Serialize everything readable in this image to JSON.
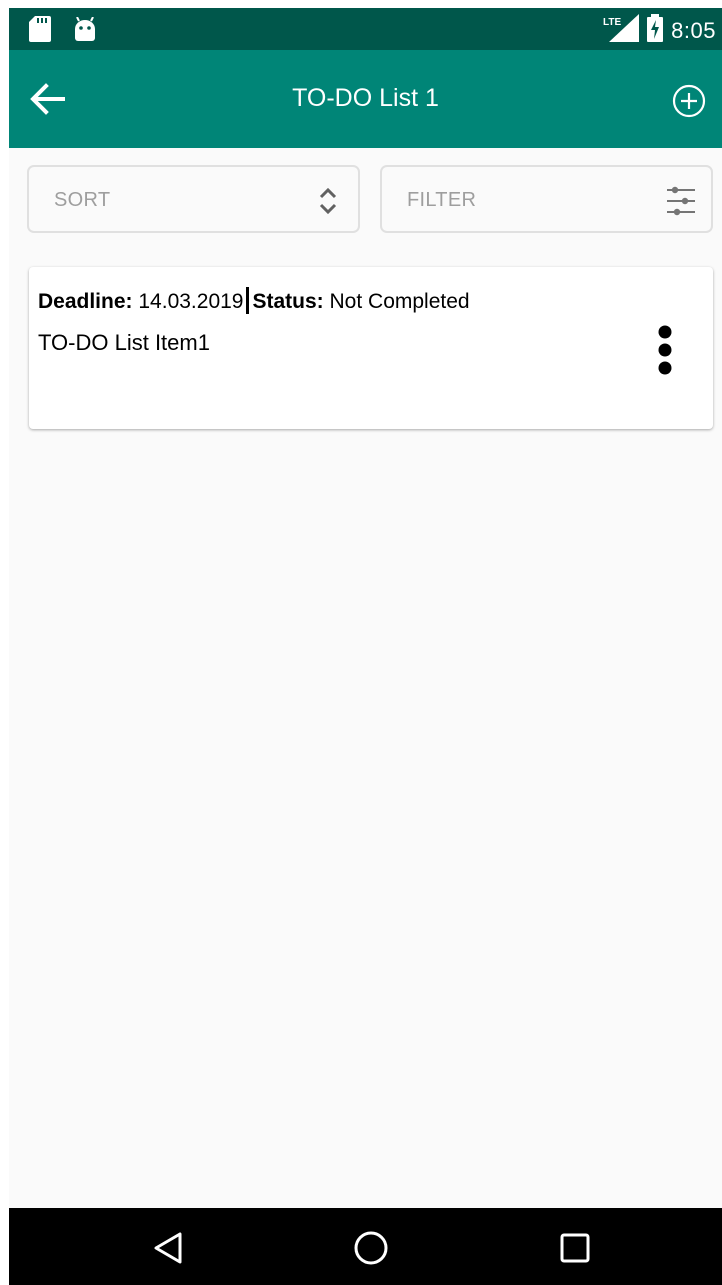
{
  "status_bar": {
    "time": "8:05",
    "network": "LTE",
    "icons": [
      "sd-card-icon",
      "android-icon",
      "lte-signal-icon",
      "battery-charging-icon"
    ]
  },
  "app_bar": {
    "title": "TO-DO List 1",
    "back_icon": "arrow-back-icon",
    "add_icon": "add-circle-icon"
  },
  "controls": {
    "sort_label": "SORT",
    "filter_label": "FILTER"
  },
  "items": [
    {
      "deadline_label": "Deadline:",
      "deadline_value": "14.03.2019",
      "status_label": "Status:",
      "status_value": "Not Completed",
      "title": "TO-DO List Item1"
    }
  ],
  "colors": {
    "status_bar": "#00574b",
    "app_bar": "#008577",
    "background": "#fafafa",
    "nav_bar": "#000000"
  }
}
